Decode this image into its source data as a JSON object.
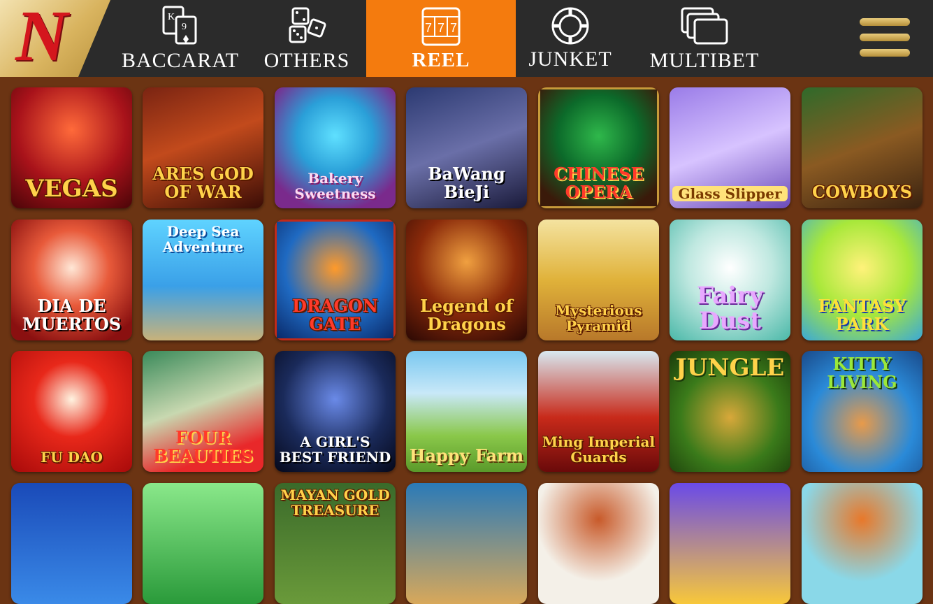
{
  "nav": {
    "tabs": [
      {
        "label": "BACCARAT",
        "icon": "cards-icon",
        "active": false
      },
      {
        "label": "OTHERS",
        "icon": "dice-icon",
        "active": false
      },
      {
        "label": "REEL",
        "icon": "slot-reel-icon",
        "active": true
      },
      {
        "label": "JUNKET",
        "icon": "poker-chip-icon",
        "active": false
      },
      {
        "label": "MULTIBET",
        "icon": "multi-window-icon",
        "active": false
      }
    ],
    "logo": "N",
    "menu_icon": "hamburger-menu-icon",
    "active_color": "#f47b0e"
  },
  "games": [
    {
      "title": "VEGAS"
    },
    {
      "title": "ARES GOD OF WAR"
    },
    {
      "title": "Bakery Sweetness"
    },
    {
      "title": "BaWang BieJi"
    },
    {
      "title": "CHINESE OPERA"
    },
    {
      "title": "Glass Slipper"
    },
    {
      "title": "COWBOYS"
    },
    {
      "title": "DIA DE MUERTOS"
    },
    {
      "title": "Deep Sea Adventure"
    },
    {
      "title": "DRAGON GATE"
    },
    {
      "title": "Legend of Dragons"
    },
    {
      "title": "Mysterious Pyramid"
    },
    {
      "title": "Fairy Dust"
    },
    {
      "title": "FANTASY PARK"
    },
    {
      "title": "FU DAO"
    },
    {
      "title": "FOUR BEAUTIES"
    },
    {
      "title": "A GIRL'S BEST FRIEND"
    },
    {
      "title": "Happy Farm"
    },
    {
      "title": "Ming Imperial Guards"
    },
    {
      "title": "JUNGLE"
    },
    {
      "title": "KITTY LIVING"
    },
    {
      "title": ""
    },
    {
      "title": ""
    },
    {
      "title": "MAYAN GOLD TREASURE"
    },
    {
      "title": ""
    },
    {
      "title": ""
    },
    {
      "title": ""
    },
    {
      "title": ""
    }
  ]
}
